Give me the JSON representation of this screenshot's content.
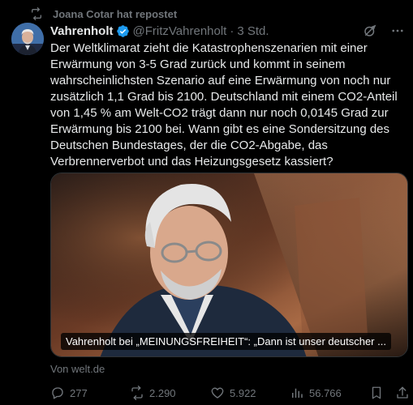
{
  "repost_label": "Joana Cotar hat repostet",
  "tweet": {
    "author_name": "Vahrenholt",
    "author_handle": "@FritzVahrenholt",
    "separator": "·",
    "time": "3 Std.",
    "text_lines": [
      "Der Weltklimarat zieht die Katastrophenszenarien mit einer",
      "Erwärmung von 3-5 Grad zurück und kommt in seinem",
      "wahrscheinlichsten Szenario auf eine Erwärmung von noch nur",
      "zusätzlich 1,1 Grad bis 2100. Deutschland mit einem CO2-Anteil",
      "von 1,45 % am Welt-CO2 trägt dann nur noch 0,0145 Grad zur",
      "Erwärmung bis 2100 bei. Wann gibt es eine Sondersitzung des",
      "Deutschen Bundestages, der die CO2-Abgabe, das",
      "Verbrennerverbot und das Heizungsgesetz kassiert?"
    ],
    "media_caption": "Vahrenholt bei „MEINUNGSFREIHEIT“: „Dann ist unser deutscher ...",
    "media_source": "Von welt.de"
  },
  "actions": {
    "replies": "277",
    "reposts": "2.290",
    "likes": "5.922",
    "views": "56.766"
  },
  "colors": {
    "background": "#000000",
    "text": "#e7e9ea",
    "muted": "#71767b",
    "verified": "#1d9bf0"
  }
}
